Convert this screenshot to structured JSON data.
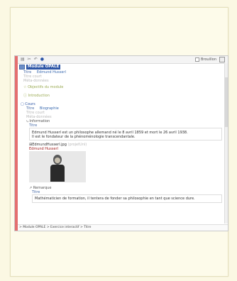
{
  "toolbar": {
    "draft_label": "Brouillon"
  },
  "module": {
    "badge": "Module OPALE",
    "title_label": "Titre",
    "title_value": "Edmund Husserl",
    "short_title": "Titre court",
    "metadata": "Méta-données",
    "objectives": "Objectifs du module",
    "intro": "Introduction"
  },
  "course": {
    "label": "Cours",
    "title_label": "Titre",
    "title_value": "Biographie",
    "short_title": "Titre court",
    "metadata": "Méta-données",
    "info_label": "Information",
    "info_title": "Titre",
    "paragraph_1": "Edmund Husserl est un philosophe allemand né le 8 avril 1859 et mort le 26 avril 1938.",
    "paragraph_2": "Il est le fondateur de la phénoménologie transcendantale.",
    "image_file": "EdmundHusserl.jpg",
    "image_suffix": "(projetUnl)",
    "image_caption": "Edmund Husserl",
    "remark_label": "Remarque",
    "remark_title": "Titre",
    "remark_text": "Mathématicien de formation, il tentera de fonder sa philosophie en tant que science dure."
  },
  "breadcrumb": "> Module OPALE > Exercice interactif > Titre"
}
